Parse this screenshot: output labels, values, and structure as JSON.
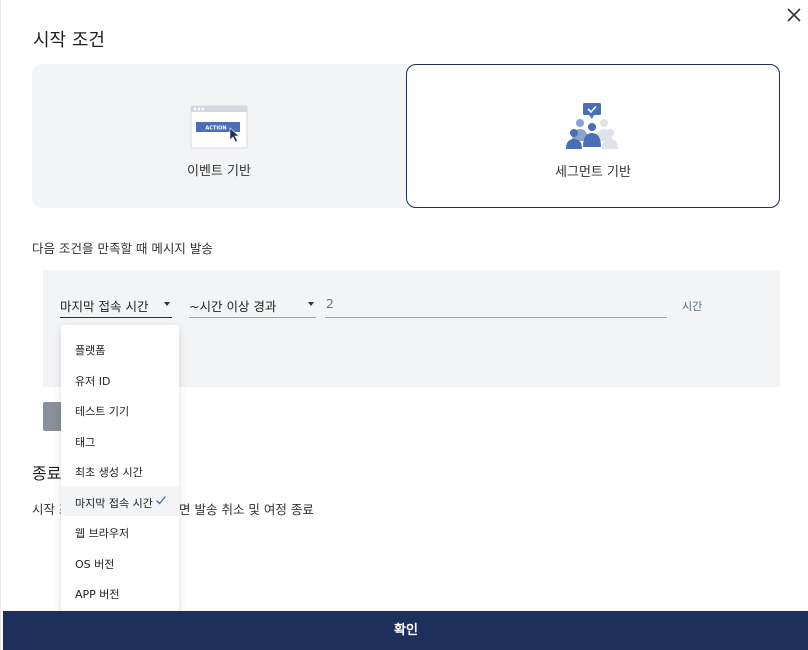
{
  "title": "시작 조건",
  "cards": [
    {
      "label": "이벤트 기반",
      "illustration_text": "ACTION",
      "selected": false
    },
    {
      "label": "세그먼트 기반",
      "selected": true
    }
  ],
  "condition_text": "다음 조건을 만족할 때 메시지 발송",
  "filter": {
    "attribute_value": "마지막 접속 시간",
    "operator_value": "~시간 이상 경과",
    "value": "2",
    "unit": "시간"
  },
  "dropdown": {
    "options": [
      "플랫폼",
      "유저 ID",
      "테스트 기기",
      "태그",
      "최초 생성 시간",
      "마지막 접속 시간",
      "웹 브라우저",
      "OS 버전",
      "APP 버전"
    ],
    "selected": "마지막 접속 시간"
  },
  "end_section": {
    "title_visible": "종료",
    "desc_left_visible": "시작 조",
    "desc_right_visible": "면 발송 취소 및 여정 종료"
  },
  "confirm_label": "확인",
  "colors": {
    "navy": "#1e2f5c",
    "panel_bg": "#f3f4f6",
    "accent_blue": "#4a6fb5"
  }
}
